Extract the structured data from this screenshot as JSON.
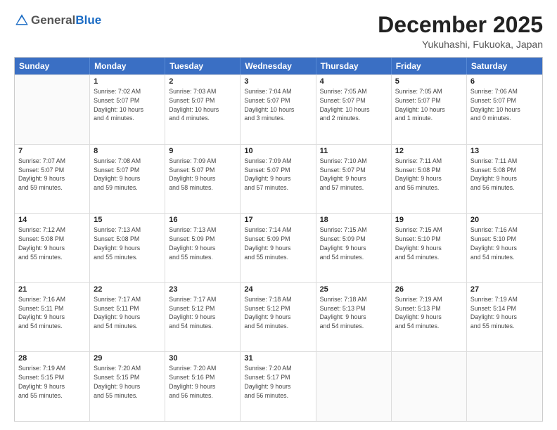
{
  "header": {
    "logo_general": "General",
    "logo_blue": "Blue",
    "month": "December 2025",
    "location": "Yukuhashi, Fukuoka, Japan"
  },
  "days": [
    "Sunday",
    "Monday",
    "Tuesday",
    "Wednesday",
    "Thursday",
    "Friday",
    "Saturday"
  ],
  "weeks": [
    [
      {
        "date": "",
        "info": ""
      },
      {
        "date": "1",
        "info": "Sunrise: 7:02 AM\nSunset: 5:07 PM\nDaylight: 10 hours\nand 4 minutes."
      },
      {
        "date": "2",
        "info": "Sunrise: 7:03 AM\nSunset: 5:07 PM\nDaylight: 10 hours\nand 4 minutes."
      },
      {
        "date": "3",
        "info": "Sunrise: 7:04 AM\nSunset: 5:07 PM\nDaylight: 10 hours\nand 3 minutes."
      },
      {
        "date": "4",
        "info": "Sunrise: 7:05 AM\nSunset: 5:07 PM\nDaylight: 10 hours\nand 2 minutes."
      },
      {
        "date": "5",
        "info": "Sunrise: 7:05 AM\nSunset: 5:07 PM\nDaylight: 10 hours\nand 1 minute."
      },
      {
        "date": "6",
        "info": "Sunrise: 7:06 AM\nSunset: 5:07 PM\nDaylight: 10 hours\nand 0 minutes."
      }
    ],
    [
      {
        "date": "7",
        "info": "Sunrise: 7:07 AM\nSunset: 5:07 PM\nDaylight: 9 hours\nand 59 minutes."
      },
      {
        "date": "8",
        "info": "Sunrise: 7:08 AM\nSunset: 5:07 PM\nDaylight: 9 hours\nand 59 minutes."
      },
      {
        "date": "9",
        "info": "Sunrise: 7:09 AM\nSunset: 5:07 PM\nDaylight: 9 hours\nand 58 minutes."
      },
      {
        "date": "10",
        "info": "Sunrise: 7:09 AM\nSunset: 5:07 PM\nDaylight: 9 hours\nand 57 minutes."
      },
      {
        "date": "11",
        "info": "Sunrise: 7:10 AM\nSunset: 5:07 PM\nDaylight: 9 hours\nand 57 minutes."
      },
      {
        "date": "12",
        "info": "Sunrise: 7:11 AM\nSunset: 5:08 PM\nDaylight: 9 hours\nand 56 minutes."
      },
      {
        "date": "13",
        "info": "Sunrise: 7:11 AM\nSunset: 5:08 PM\nDaylight: 9 hours\nand 56 minutes."
      }
    ],
    [
      {
        "date": "14",
        "info": "Sunrise: 7:12 AM\nSunset: 5:08 PM\nDaylight: 9 hours\nand 55 minutes."
      },
      {
        "date": "15",
        "info": "Sunrise: 7:13 AM\nSunset: 5:08 PM\nDaylight: 9 hours\nand 55 minutes."
      },
      {
        "date": "16",
        "info": "Sunrise: 7:13 AM\nSunset: 5:09 PM\nDaylight: 9 hours\nand 55 minutes."
      },
      {
        "date": "17",
        "info": "Sunrise: 7:14 AM\nSunset: 5:09 PM\nDaylight: 9 hours\nand 55 minutes."
      },
      {
        "date": "18",
        "info": "Sunrise: 7:15 AM\nSunset: 5:09 PM\nDaylight: 9 hours\nand 54 minutes."
      },
      {
        "date": "19",
        "info": "Sunrise: 7:15 AM\nSunset: 5:10 PM\nDaylight: 9 hours\nand 54 minutes."
      },
      {
        "date": "20",
        "info": "Sunrise: 7:16 AM\nSunset: 5:10 PM\nDaylight: 9 hours\nand 54 minutes."
      }
    ],
    [
      {
        "date": "21",
        "info": "Sunrise: 7:16 AM\nSunset: 5:11 PM\nDaylight: 9 hours\nand 54 minutes."
      },
      {
        "date": "22",
        "info": "Sunrise: 7:17 AM\nSunset: 5:11 PM\nDaylight: 9 hours\nand 54 minutes."
      },
      {
        "date": "23",
        "info": "Sunrise: 7:17 AM\nSunset: 5:12 PM\nDaylight: 9 hours\nand 54 minutes."
      },
      {
        "date": "24",
        "info": "Sunrise: 7:18 AM\nSunset: 5:12 PM\nDaylight: 9 hours\nand 54 minutes."
      },
      {
        "date": "25",
        "info": "Sunrise: 7:18 AM\nSunset: 5:13 PM\nDaylight: 9 hours\nand 54 minutes."
      },
      {
        "date": "26",
        "info": "Sunrise: 7:19 AM\nSunset: 5:13 PM\nDaylight: 9 hours\nand 54 minutes."
      },
      {
        "date": "27",
        "info": "Sunrise: 7:19 AM\nSunset: 5:14 PM\nDaylight: 9 hours\nand 55 minutes."
      }
    ],
    [
      {
        "date": "28",
        "info": "Sunrise: 7:19 AM\nSunset: 5:15 PM\nDaylight: 9 hours\nand 55 minutes."
      },
      {
        "date": "29",
        "info": "Sunrise: 7:20 AM\nSunset: 5:15 PM\nDaylight: 9 hours\nand 55 minutes."
      },
      {
        "date": "30",
        "info": "Sunrise: 7:20 AM\nSunset: 5:16 PM\nDaylight: 9 hours\nand 56 minutes."
      },
      {
        "date": "31",
        "info": "Sunrise: 7:20 AM\nSunset: 5:17 PM\nDaylight: 9 hours\nand 56 minutes."
      },
      {
        "date": "",
        "info": ""
      },
      {
        "date": "",
        "info": ""
      },
      {
        "date": "",
        "info": ""
      }
    ]
  ]
}
